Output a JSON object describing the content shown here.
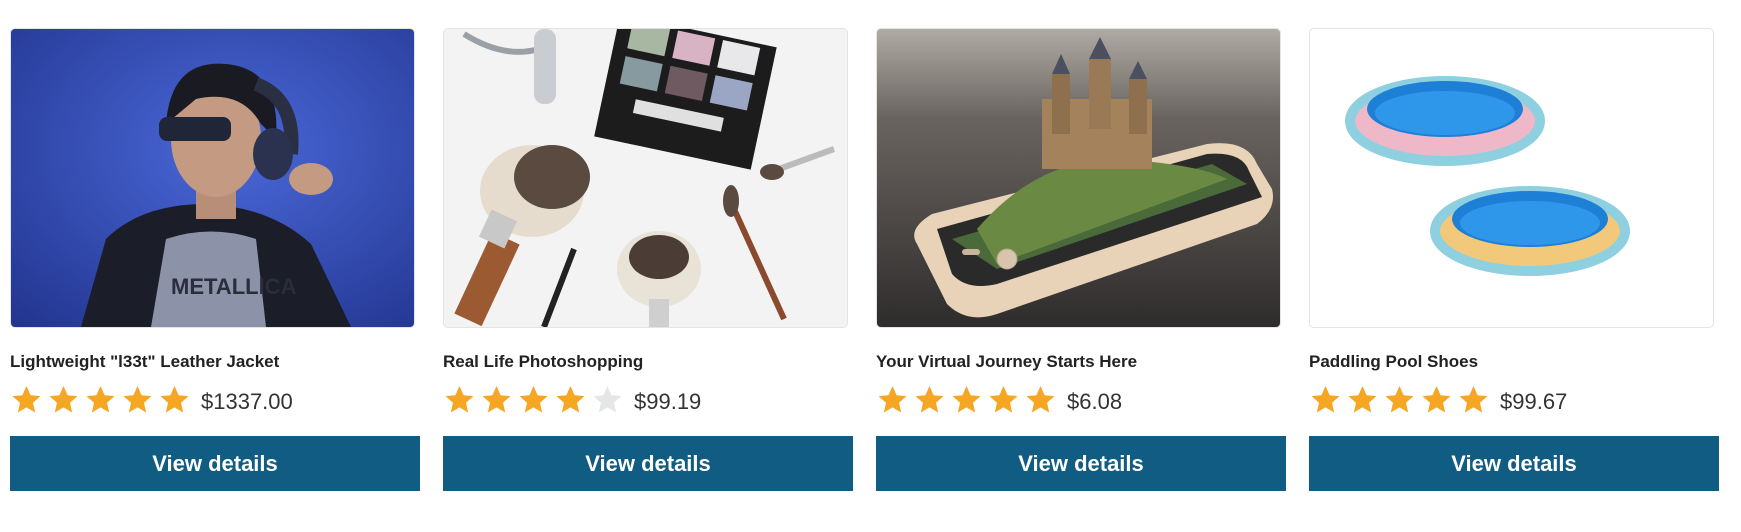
{
  "products": [
    {
      "title": "Lightweight \"l33t\" Leather Jacket",
      "image": "woman-with-headphones-photo",
      "rating": 5,
      "rating_max": 5,
      "price": "$1337.00",
      "button_label": "View details"
    },
    {
      "title": "Real Life Photoshopping",
      "image": "makeup-brushes-and-eyeshadow-photo",
      "rating": 4,
      "rating_max": 5,
      "price": "$99.19",
      "button_label": "View details"
    },
    {
      "title": "Your Virtual Journey Starts Here",
      "image": "castle-on-smartphone-photo",
      "rating": 5,
      "rating_max": 5,
      "price": "$6.08",
      "button_label": "View details"
    },
    {
      "title": "Paddling Pool Shoes",
      "image": "inflatable-pools-photo",
      "rating": 5,
      "rating_max": 5,
      "price": "$99.67",
      "button_label": "View details"
    }
  ],
  "colors": {
    "button_bg": "#115c82",
    "star_filled": "#f5a623",
    "star_empty": "#e4e7ea"
  }
}
